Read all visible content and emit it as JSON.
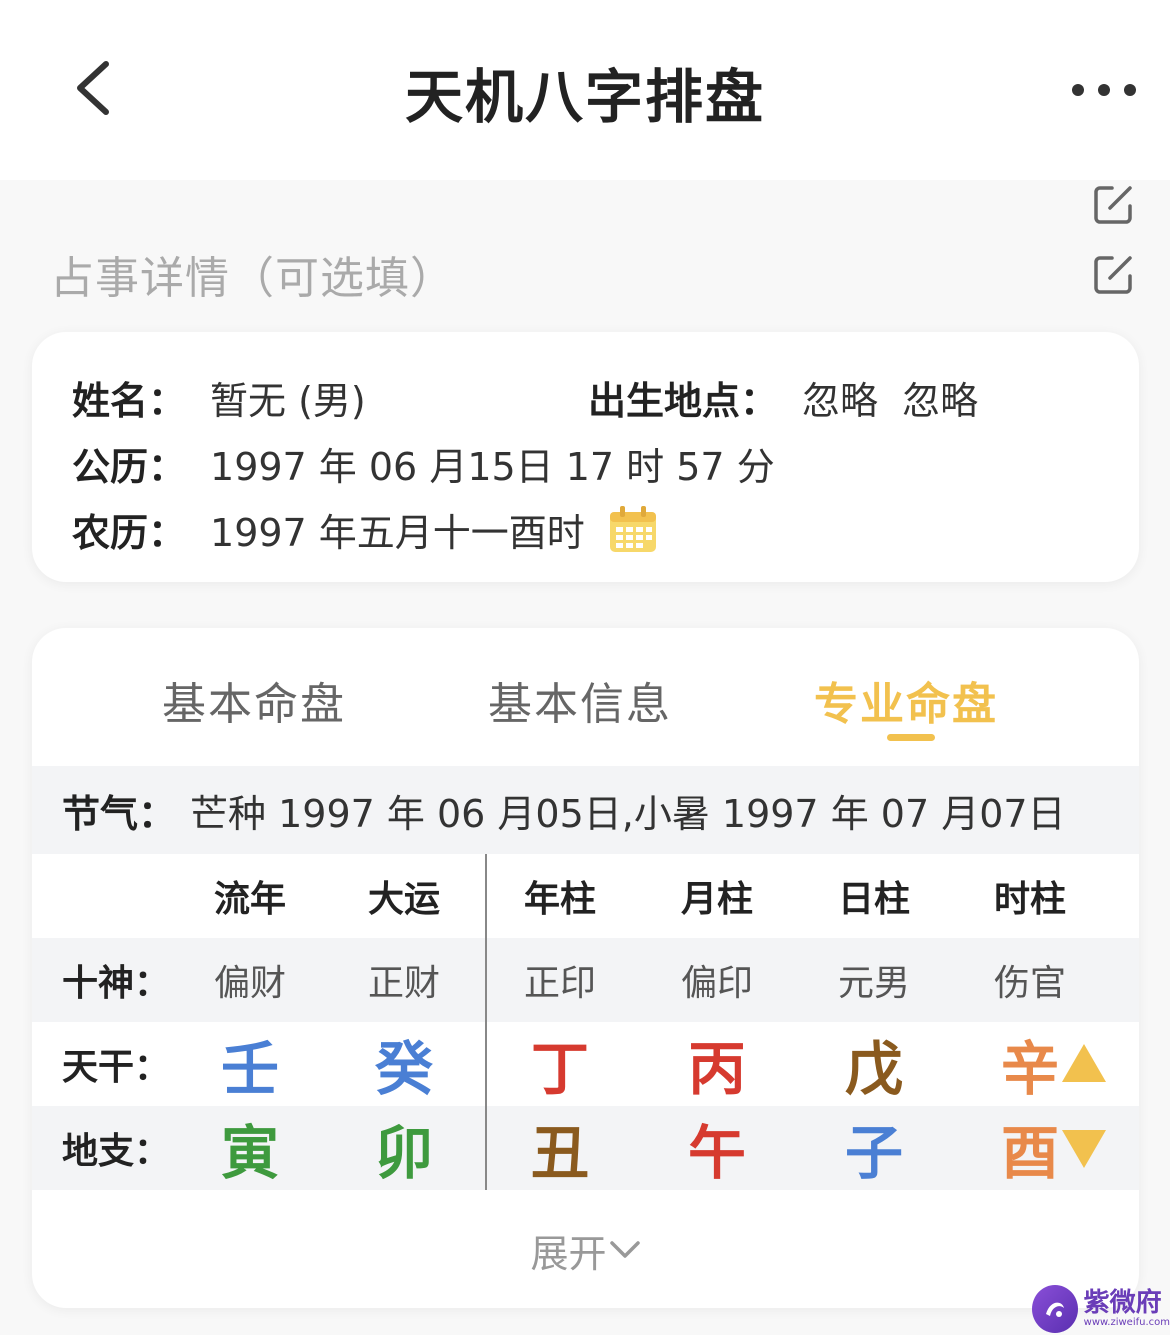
{
  "header": {
    "title": "天机八字排盘"
  },
  "detail": {
    "label": "占事详情（可选填）"
  },
  "info": {
    "name_label": "姓名：",
    "name_value": "暂无 (男)",
    "birthplace_label": "出生地点：",
    "birthplace_value": "忽略  忽略",
    "solar_label": "公历：",
    "solar_value": "1997 年 06 月15日 17 时 57 分",
    "lunar_label": "农历：",
    "lunar_value": "1997 年五月十一酉时"
  },
  "tabs": [
    {
      "label": "基本命盘"
    },
    {
      "label": "基本信息"
    },
    {
      "label": "专业命盘"
    }
  ],
  "jieqi": {
    "label": "节气：",
    "value": "芒种 1997 年 06 月05日,小暑 1997 年 07 月07日"
  },
  "pillars": {
    "headers": [
      "流年",
      "大运",
      "年柱",
      "月柱",
      "日柱",
      "时柱"
    ],
    "shishen_label": "十神：",
    "shishen": [
      "偏财",
      "正财",
      "正印",
      "偏印",
      "元男",
      "伤官"
    ],
    "tiangan_label": "天干：",
    "tiangan": [
      "壬",
      "癸",
      "丁",
      "丙",
      "戊",
      "辛"
    ],
    "dizhi_label": "地支：",
    "dizhi": [
      "寅",
      "卯",
      "丑",
      "午",
      "子",
      "酉"
    ],
    "colors": {
      "blue": "#4a7fd4",
      "green": "#3e9a3e",
      "red": "#d63a2f",
      "brown": "#8a5a1e",
      "orange": "#e8894a",
      "gold": "#f2c14e"
    }
  },
  "expand": {
    "label": "展开"
  },
  "watermark": {
    "name": "紫微府",
    "url": "www.ziweifu.com"
  }
}
